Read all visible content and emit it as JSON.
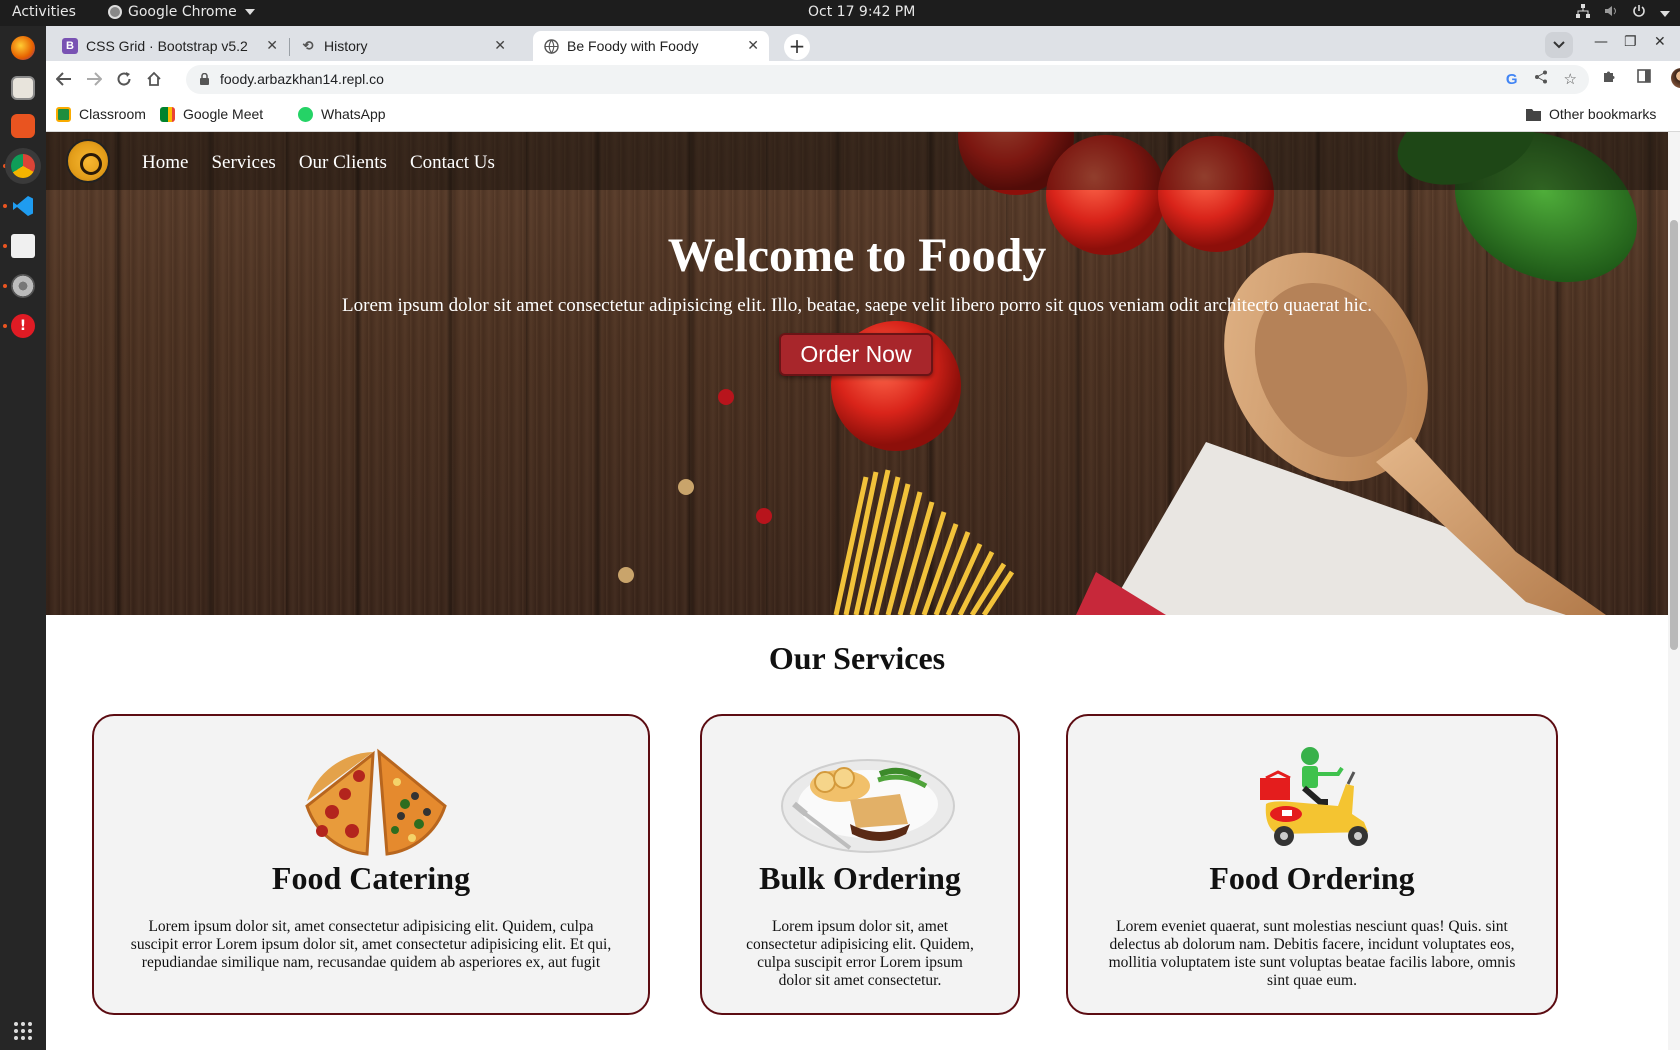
{
  "system": {
    "activities": "Activities",
    "app_name": "Google Chrome",
    "clock": "Oct 17  9:42 PM"
  },
  "browser": {
    "tabs": [
      {
        "title": "CSS Grid · Bootstrap v5.2",
        "favicon": "bootstrap-icon",
        "favicon_color": "#7952b3",
        "active": false
      },
      {
        "title": "History",
        "favicon": "history-icon",
        "active": false
      },
      {
        "title": "Be Foody with Foody",
        "favicon": "globe-icon",
        "active": true
      }
    ],
    "url": "foody.arbazkhan14.repl.co",
    "bookmarks": [
      {
        "label": "Classroom",
        "icon": "classroom-icon",
        "color": "#1e8e3e"
      },
      {
        "label": "Google Meet",
        "icon": "meet-icon",
        "color": "#00832d"
      },
      {
        "label": "WhatsApp",
        "icon": "whatsapp-icon",
        "color": "#25d366"
      }
    ],
    "other_bookmarks": "Other bookmarks"
  },
  "site": {
    "nav": [
      "Home",
      "Services",
      "Our Clients",
      "Contact Us"
    ],
    "hero": {
      "title": "Welcome to Foody",
      "subtitle": "Lorem ipsum dolor sit amet consectetur adipisicing elit. Illo, beatae, saepe velit libero porro sit quos veniam odit architecto quaerat hic.",
      "cta": "Order Now"
    },
    "services_title": "Our Services",
    "services": [
      {
        "title": "Food Catering",
        "image": "pizza-image",
        "text": "Lorem ipsum dolor sit, amet consectetur adipisicing elit. Quidem, culpa suscipit error Lorem ipsum dolor sit, amet consectetur adipisicing elit. Et qui, repudiandae similique nam, recusandae quidem ab asperiores ex, aut fugit"
      },
      {
        "title": "Bulk Ordering",
        "image": "plated-meal-image",
        "text": "Lorem ipsum dolor sit, amet consectetur adipisicing elit. Quidem, culpa suscipit error Lorem ipsum dolor sit amet consectetur."
      },
      {
        "title": "Food Ordering",
        "image": "delivery-scooter-image",
        "text": "Lorem eveniet quaerat, sunt molestias nesciunt quas! Quis. sint delectus ab dolorum nam. Debitis facere, incidunt voluptates eos, mollitia voluptatem iste sunt voluptas beatae facilis labore, omnis sint quae eum."
      }
    ]
  },
  "colors": {
    "accent_red": "#a8262b",
    "card_border": "#5c0c12",
    "card_bg": "#f3f3f3"
  }
}
